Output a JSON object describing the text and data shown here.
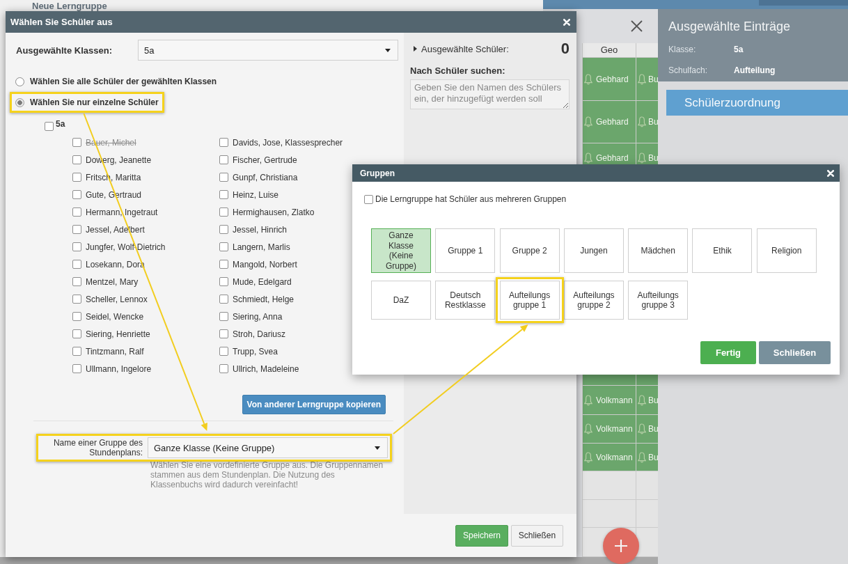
{
  "background_dialog": {
    "title": "Neue Lerngruppe"
  },
  "schedule": {
    "columns": [
      "Geo"
    ],
    "rows": [
      {
        "kind": "lesson",
        "cells": [
          "Gebhard",
          "Bu"
        ]
      },
      {
        "kind": "lesson",
        "cells": [
          "Gebhard",
          "Bu"
        ]
      },
      {
        "kind": "lesson",
        "cells": [
          "Gebhard",
          "Bu"
        ]
      },
      {
        "kind": "lesson"
      },
      {
        "kind": "lesson",
        "cells": [
          "Volkmann",
          "Bu"
        ]
      },
      {
        "kind": "lesson",
        "cells": [
          "Volkmann",
          "Bu"
        ]
      },
      {
        "kind": "lesson",
        "cells": [
          "Volkmann",
          "Bu"
        ]
      },
      {
        "kind": "empty"
      },
      {
        "kind": "empty"
      },
      {
        "kind": "empty"
      }
    ]
  },
  "selection_panel": {
    "title": "Ausgewählte Einträge",
    "fields": [
      {
        "label": "Klasse:",
        "value": "5a"
      },
      {
        "label": "Schulfach:",
        "value": "Aufteilung"
      }
    ],
    "action": "Schülerzuordnung"
  },
  "student_dialog": {
    "title": "Wählen Sie Schüler aus",
    "class_field": {
      "label": "Ausgewählte Klassen:",
      "value": "5a"
    },
    "modes": [
      {
        "label": "Wählen Sie alle Schüler der gewählten Klassen",
        "selected": false,
        "highlighted": false
      },
      {
        "label": "Wählen Sie nur einzelne Schüler",
        "selected": true,
        "highlighted": true
      }
    ],
    "class_group": {
      "label": "5a",
      "checked": false
    },
    "students": [
      {
        "name": "Bauer, Michel",
        "checked": false,
        "inactive": true
      },
      {
        "name": "Davids, Jose, Klassesprecher",
        "checked": false,
        "inactive": false
      },
      {
        "name": "Dowerg, Jeanette",
        "checked": false,
        "inactive": false
      },
      {
        "name": "Fischer, Gertrude",
        "checked": false,
        "inactive": false
      },
      {
        "name": "Fritsch, Maritta",
        "checked": false,
        "inactive": false
      },
      {
        "name": "Gunpf, Christiana",
        "checked": false,
        "inactive": false
      },
      {
        "name": "Gute, Gertraud",
        "checked": false,
        "inactive": false
      },
      {
        "name": "Heinz, Luise",
        "checked": false,
        "inactive": false
      },
      {
        "name": "Hermann, Ingetraut",
        "checked": false,
        "inactive": false
      },
      {
        "name": "Hermighausen, Zlatko",
        "checked": false,
        "inactive": false
      },
      {
        "name": "Jessel, Adelbert",
        "checked": false,
        "inactive": false
      },
      {
        "name": "Jessel, Hinrich",
        "checked": false,
        "inactive": false
      },
      {
        "name": "Jungfer, Wolf-Dietrich",
        "checked": false,
        "inactive": false
      },
      {
        "name": "Langern, Marlis",
        "checked": false,
        "inactive": false
      },
      {
        "name": "Losekann, Dora",
        "checked": false,
        "inactive": false
      },
      {
        "name": "Mangold, Norbert",
        "checked": false,
        "inactive": false
      },
      {
        "name": "Mentzel, Mary",
        "checked": false,
        "inactive": false
      },
      {
        "name": "Mude, Edelgard",
        "checked": false,
        "inactive": false
      },
      {
        "name": "Scheller, Lennox",
        "checked": false,
        "inactive": false
      },
      {
        "name": "Schmiedt, Helge",
        "checked": false,
        "inactive": false
      },
      {
        "name": "Seidel, Wencke",
        "checked": false,
        "inactive": false
      },
      {
        "name": "Siering, Anna",
        "checked": false,
        "inactive": false
      },
      {
        "name": "Siering, Henriette",
        "checked": false,
        "inactive": false
      },
      {
        "name": "Stroh, Dariusz",
        "checked": false,
        "inactive": false
      },
      {
        "name": "Tintzmann, Ralf",
        "checked": false,
        "inactive": false
      },
      {
        "name": "Trupp, Svea",
        "checked": false,
        "inactive": false
      },
      {
        "name": "Ullmann, Ingelore",
        "checked": false,
        "inactive": false
      },
      {
        "name": "Ullrich, Madeleine",
        "checked": false,
        "inactive": false
      }
    ],
    "copy_button": "Von anderer Lerngruppe kopieren",
    "group_field": {
      "label": "Name einer Gruppe des Stundenplans:",
      "value": "Ganze Klasse (Keine Gruppe)",
      "highlighted": true,
      "help": "Wählen Sie eine vordefinierte Gruppe aus. Die Gruppennamen stammen aus dem Stundenplan. Die Nutzung des Klassenbuchs wird dadurch vereinfacht!"
    },
    "sidebar": {
      "selected_label": "Ausgewählte Schüler:",
      "expanded": false,
      "selected_count": "0",
      "search_label": "Nach Schüler suchen:",
      "search_placeholder": "Geben Sie den Namen des Schülers ein, der hinzugefügt werden soll"
    },
    "buttons": [
      {
        "label": "Speichern",
        "kind": "primary"
      },
      {
        "label": "Schließen",
        "kind": "default"
      }
    ]
  },
  "groups_dialog": {
    "title": "Gruppen",
    "multi_group": {
      "label": "Die Lerngruppe hat Schüler aus mehreren Gruppen",
      "checked": false
    },
    "groups": [
      {
        "label": "Ganze Klasse (Keine Gruppe)",
        "selected": true,
        "highlighted": false
      },
      {
        "label": "Gruppe 1",
        "selected": false,
        "highlighted": false
      },
      {
        "label": "Gruppe 2",
        "selected": false,
        "highlighted": false
      },
      {
        "label": "Jungen",
        "selected": false,
        "highlighted": false
      },
      {
        "label": "Mädchen",
        "selected": false,
        "highlighted": false
      },
      {
        "label": "Ethik",
        "selected": false,
        "highlighted": false
      },
      {
        "label": "Religion",
        "selected": false,
        "highlighted": false
      },
      {
        "label": "DaZ",
        "selected": false,
        "highlighted": false
      },
      {
        "label": "Deutsch Restklasse",
        "selected": false,
        "highlighted": false
      },
      {
        "label": "Aufteilungs gruppe 1",
        "selected": false,
        "highlighted": true
      },
      {
        "label": "Aufteilungs gruppe 2",
        "selected": false,
        "highlighted": false
      },
      {
        "label": "Aufteilungs gruppe 3",
        "selected": false,
        "highlighted": false
      }
    ],
    "buttons": [
      {
        "label": "Fertig",
        "kind": "primary"
      },
      {
        "label": "Schließen",
        "kind": "secondary"
      }
    ]
  }
}
